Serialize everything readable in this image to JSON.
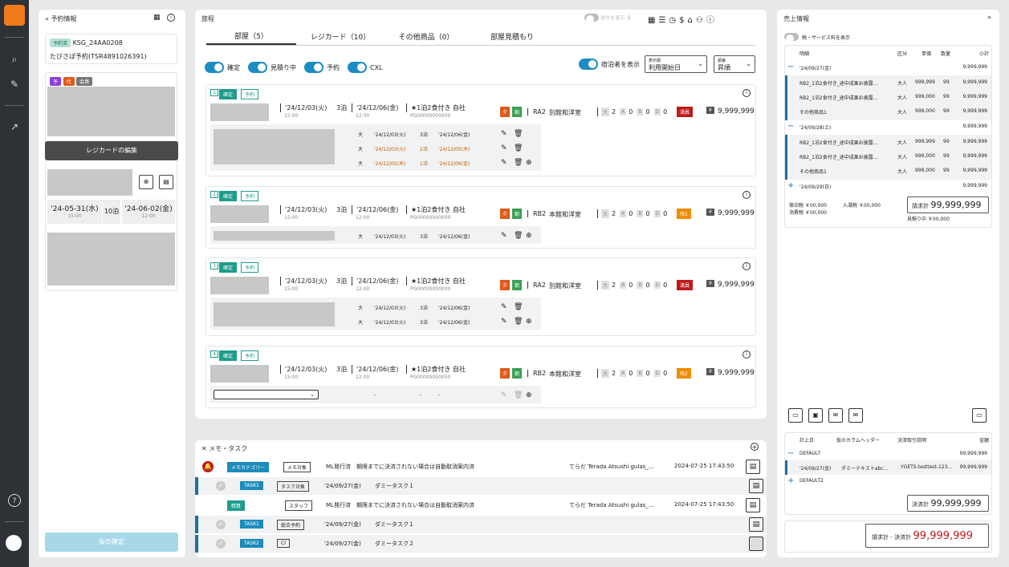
{
  "nav": {
    "logo": "logo",
    "items": [
      "search-icon",
      "edit-icon",
      "open-external-icon",
      "help-icon"
    ]
  },
  "left": {
    "title": "予約情報",
    "status_tag": "予約済",
    "booking_id": "KSG_24AA0208",
    "agent": "たびさぽ予約(TSR4891026391)",
    "tags": [
      "予",
      "代",
      "会員"
    ],
    "regi_btn": "レジカードの編集",
    "checkin_date": "'24-05-31(水)",
    "checkin_time": "15:00",
    "nights": "10泊",
    "checkout_date": "'24-06-02(金)",
    "checkout_time": "12:00",
    "confirm_btn": "仮の確定"
  },
  "center": {
    "title": "旅程",
    "price_toggle": "税サを表示",
    "tabs": [
      "部屋（5）",
      "レジカード（10）",
      "その他商品（0）",
      "部屋見積もり"
    ],
    "filters": [
      "確定",
      "見積り中",
      "予約",
      "CXL"
    ],
    "show_guests": "宿泊者を表示",
    "sort_label": "表示順",
    "sort_value": "利用開始日",
    "order_label": "順番",
    "order_value": "昇順"
  },
  "rooms": [
    {
      "num": "1",
      "in": "'24/12/03(火)",
      "in_t": "15:00",
      "n": "3泊",
      "out": "'24/12/06(金)",
      "out_t": "12:00",
      "plan": "★1泊2食付き 自社",
      "code": "PG00000000000",
      "room_code": "RA2",
      "room": "別館和洋室",
      "adult": "2",
      "a": "0",
      "b": "0",
      "d": "0",
      "badge": "満員",
      "price": "9,999,999",
      "subs": [
        [
          "大",
          "'24/12/03(火)",
          "3泊",
          "'24/12/06(金)"
        ],
        [
          "大",
          "'24/12/03(火)",
          "2泊",
          "'24/12/05(木)"
        ],
        [
          "大",
          "'24/12/05(木)",
          "1泊",
          "'24/12/06(金)"
        ]
      ]
    },
    {
      "num": "2",
      "in": "'24/12/03(火)",
      "in_t": "15:00",
      "n": "3泊",
      "out": "'24/12/06(金)",
      "out_t": "12:00",
      "plan": "★1泊2食付き 自社",
      "code": "PG00000000000",
      "room_code": "RB2",
      "room": "本館和洋室",
      "adult": "2",
      "a": "0",
      "b": "0",
      "d": "0",
      "badge": "残1",
      "price": "9,999,999",
      "subs": [
        [
          "大",
          "'24/12/03(火)",
          "3泊",
          "'24/12/06(金)"
        ]
      ]
    },
    {
      "num": "3",
      "in": "'24/12/03(火)",
      "in_t": "15:00",
      "n": "3泊",
      "out": "'24/12/06(金)",
      "out_t": "12:00",
      "plan": "★1泊2食付き 自社",
      "code": "PG00000000000",
      "room_code": "RA2",
      "room": "別館和洋室",
      "adult": "2",
      "a": "0",
      "b": "0",
      "d": "0",
      "badge": "満員",
      "price": "9,999,999",
      "subs": [
        [
          "大",
          "'24/12/03(火)",
          "3泊",
          "'24/12/06(金)"
        ],
        [
          "大",
          "'24/12/03(火)",
          "3泊",
          "'24/12/06(金)"
        ]
      ]
    },
    {
      "num": "4",
      "in": "'24/12/03(火)",
      "in_t": "15:00",
      "n": "3泊",
      "out": "'24/12/06(金)",
      "out_t": "12:00",
      "plan": "★1泊2食付き 自社",
      "code": "PG00000000000",
      "room_code": "RB2",
      "room": "本館和洋室",
      "adult": "2",
      "a": "0",
      "b": "0",
      "d": "0",
      "badge": "残2",
      "price": "9,999,999",
      "subs": [
        [
          "",
          "-",
          "-",
          "-"
        ]
      ]
    }
  ],
  "tags": {
    "confirmed": "確定",
    "reserved": "予約",
    "dinner": "夕",
    "breakfast": "朝",
    "adult_lbl": "大",
    "a_lbl": "A",
    "b_lbl": "B",
    "d_lbl": "D",
    "yen": "¥"
  },
  "memo": {
    "title": "メモ・タスク",
    "rows": [
      {
        "tag": "メモカテゴリー",
        "type": "メモ対象",
        "text": "ML発行済　期限までに決済されない場合は自動取消案内済",
        "user": "てらだ Terada Atsushi gulas_…",
        "time": "2024-07-25 17:43:50"
      },
      {
        "tag": "TASK1",
        "type": "タスク対象",
        "date": "'24/09/27(金)",
        "text": "ダミータスク１"
      },
      {
        "tag": "精算",
        "type": "スタッフ",
        "text": "ML発行済　期限までに決済されない場合は自動取消案内済",
        "user": "てらだ Terada Atsushi gulas_…",
        "time": "2024-07-25 17:43:50"
      },
      {
        "tag": "TASK1",
        "type": "総合予約",
        "date": "'24/09/27(金)",
        "text": "ダミータスク１"
      },
      {
        "tag": "TASK2",
        "type": "CI",
        "date": "'24/09/27(金)",
        "text": "ダミータスク２"
      }
    ]
  },
  "sales": {
    "title": "売上情報",
    "toggle": "税・サービス料を表示",
    "cols": [
      "明細",
      "区分",
      "単価",
      "数量",
      "小計"
    ],
    "groups": [
      {
        "date": "'24/09/27(金)",
        "total": "9,999,999",
        "items": [
          [
            "RB2_1泊2食付き_途中成果お披露…",
            "大人",
            "999,999",
            "99",
            "9,999,999"
          ],
          [
            "RB2_1泊2食付き_途中成果お披露…",
            "大人",
            "999,000",
            "99",
            "9,999,999"
          ],
          [
            "その他商品1",
            "大人",
            "999,000",
            "99",
            "9,999,999"
          ]
        ]
      },
      {
        "date": "'24/09/28(土)",
        "total": "9,999,999",
        "items": [
          [
            "RB2_1泊2食付き_途中成果お披露…",
            "大人",
            "999,999",
            "99",
            "9,999,999"
          ],
          [
            "RB2_1泊2食付き_途中成果お披露…",
            "大人",
            "999,000",
            "99",
            "9,999,999"
          ],
          [
            "その他商品1",
            "大人",
            "999,000",
            "99",
            "9,999,999"
          ]
        ]
      },
      {
        "date": "'24/09/29(日)",
        "total": "9,999,999",
        "items": []
      }
    ],
    "tax1": "宿泊税 ￥00,000",
    "tax2": "消費税 ￥00,000",
    "bath": "入湯税 ￥00,000",
    "bill_label": "請求計",
    "bill": "99,999,999",
    "estimate": "見積り中 ￥00,000",
    "pay_cols": [
      "計上日",
      "仮のカラムヘッダー",
      "決済取引説明",
      "金額"
    ],
    "pay_groups": [
      {
        "name": "DEFAULT",
        "total": "99,999,999",
        "items": [
          [
            "'24/09/27(金)",
            "ダミーテキストabc…",
            "YGETS-testtest-123…",
            "99,999,999"
          ]
        ]
      },
      {
        "name": "DEFAULT2"
      }
    ],
    "settle_label": "決済計",
    "settle": "99,999,999",
    "diff_label": "請求計 - 決済計",
    "diff": "99,999,999"
  },
  "colors": {
    "accent": "#1a8dc4",
    "teal": "#1e9c8c",
    "red": "#c01a1a",
    "orange": "#f08c00",
    "dark": "#2e3135"
  }
}
